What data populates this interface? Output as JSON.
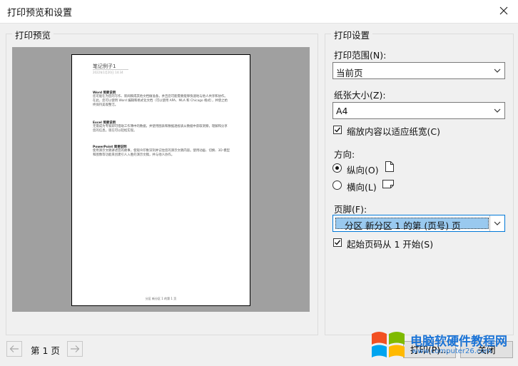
{
  "window": {
    "title": "打印预览和设置"
  },
  "preview": {
    "group_label": "打印预览",
    "doc": {
      "title": "笔记例子1",
      "meta": "2022年1月20日    14:34",
      "sections": [
        {
          "heading": "Word 简要说明",
          "text": "您可能在为您的写作、新闻稿或其他文档做准备，并且您可能需要能够快速地与他人共享和协作。在此，您可以使用 Word 编辑和格式化文档（可以使用 APA、MLA 和 Chicago 格式），并使之始终保持美观整洁。"
        },
        {
          "heading": "Excel 简要说明",
          "text": "无需成为专家即可借助工作簿中的数据，并使用图表和数据透视表从数据中获取洞察，理解和分享您的信息。现在可以轻松实现。"
        },
        {
          "heading": "PowerPoint 简要说明",
          "text": "使用演示文稿讲述您的故事，使观众印象深刻并记住您的演示文稿内容。使用动画、切换、3D 模型和图像等功能来创建引人入胜的演示文稿，并与他人协作。"
        }
      ],
      "footer": "分区 新分区 1 的第 1 页"
    }
  },
  "settings": {
    "group_label": "打印设置",
    "range_label": "打印范围(N):",
    "range_value": "当前页",
    "paper_label": "纸张大小(Z):",
    "paper_value": "A4",
    "fit_label": "缩放内容以适应纸宽(C)",
    "orient_label": "方向:",
    "portrait_label": "纵向(O)",
    "landscape_label": "横向(L)",
    "footer_label": "页脚(F):",
    "footer_value": "分区 新分区 1 的第 (页号) 页",
    "startpage_label": "起始页码从 1 开始(S)"
  },
  "bottom": {
    "page_label": "第 1 页",
    "print_button": "打印(P)...",
    "close_button": "关闭"
  },
  "watermark": {
    "text": "电脑软硬件教程网",
    "url": "www.computer26.com"
  }
}
